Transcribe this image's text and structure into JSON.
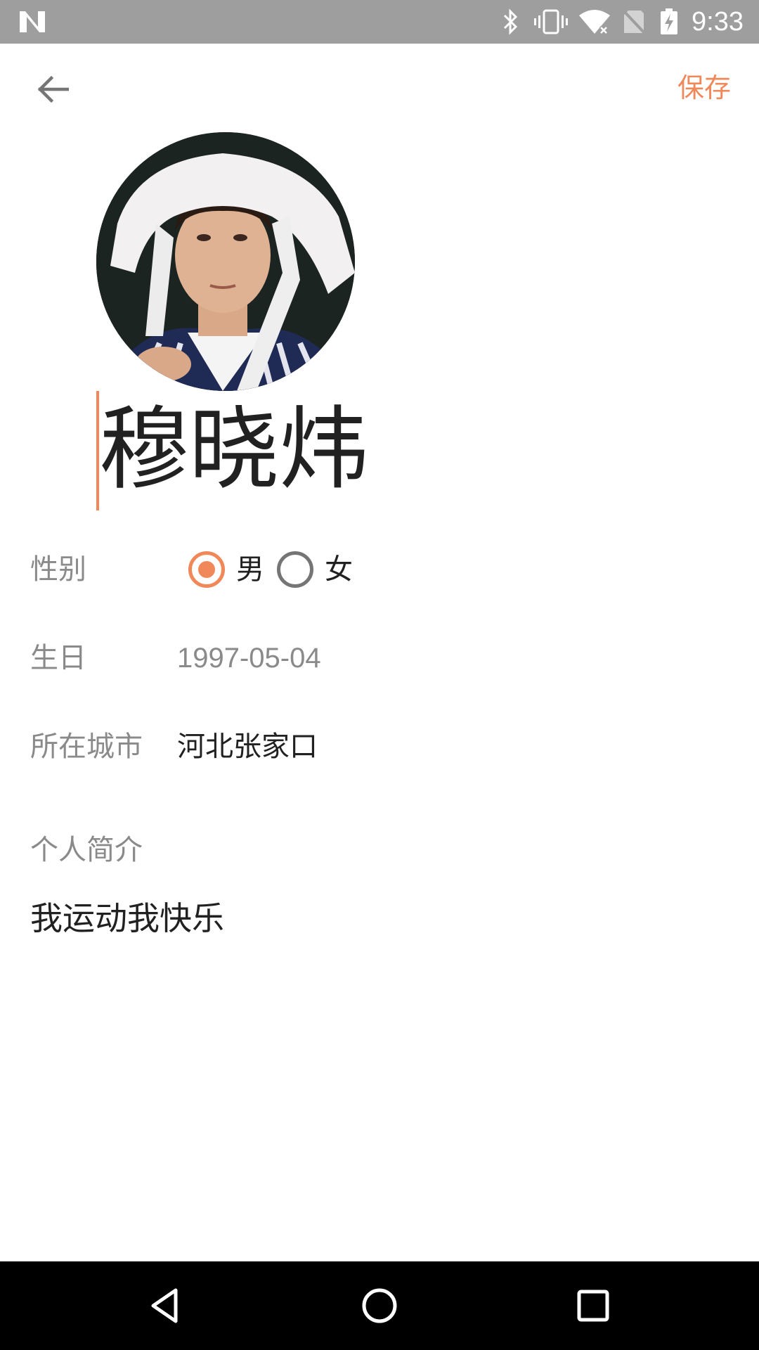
{
  "status_bar": {
    "time": "9:33",
    "icons": [
      "n-logo-icon",
      "bluetooth-icon",
      "vibrate-icon",
      "wifi-icon",
      "no-sim-icon",
      "battery-charging-icon"
    ],
    "background": "#9e9e9e"
  },
  "app_bar": {
    "back_icon": "arrow-left-icon",
    "save_label": "保存"
  },
  "profile": {
    "avatar": "profile-photo",
    "name": "穆晓炜"
  },
  "form": {
    "gender": {
      "label": "性别",
      "options": [
        "男",
        "女"
      ],
      "selected": "男"
    },
    "birthday": {
      "label": "生日",
      "value": "1997-05-04"
    },
    "city": {
      "label": "所在城市",
      "value": "河北张家口"
    },
    "bio": {
      "label": "个人简介",
      "value": "我运动我快乐"
    }
  },
  "nav_bar": {
    "buttons": [
      "back-triangle-icon",
      "home-circle-icon",
      "recents-square-icon"
    ]
  },
  "colors": {
    "accent": "#f0885a",
    "label_gray": "#8a8a8a",
    "text": "#212121"
  }
}
